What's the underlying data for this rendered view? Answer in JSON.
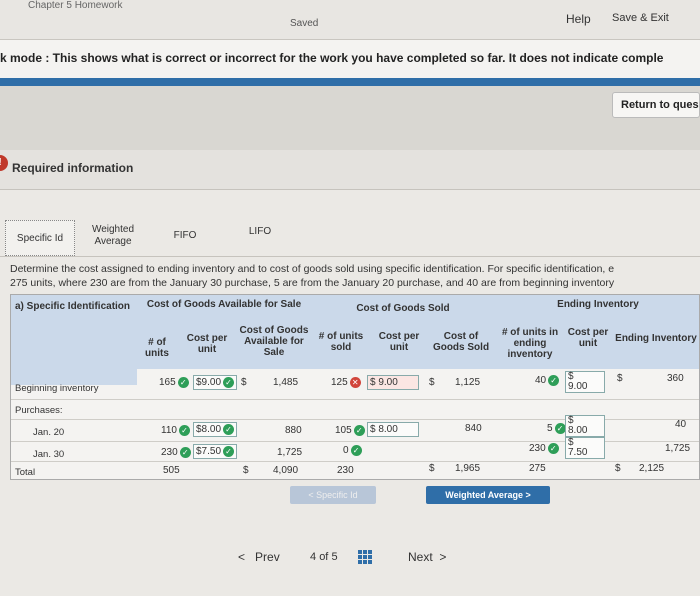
{
  "topbar": {
    "chapter": "Chapter 5 Homework",
    "saved": "Saved",
    "help": "Help",
    "save_exit": "Save & Exit"
  },
  "banner": {
    "text": "k mode : This shows what is correct or incorrect for the work you have completed so far. It does not indicate comple"
  },
  "return_button": "Return to ques",
  "required": {
    "icon": "!",
    "label": "Required information"
  },
  "tabs": [
    {
      "label": "Specific Id"
    },
    {
      "label": "Weighted Average"
    },
    {
      "label": "FIFO"
    },
    {
      "label": "LIFO"
    }
  ],
  "instructions": {
    "line1": "Determine the cost assigned to ending inventory and to cost of goods sold using specific identification. For specific identification, e",
    "line2": "275 units, where 230 are from the January 30 purchase, 5 are from the January 20 purchase, and 40 are from beginning inventory"
  },
  "table": {
    "corner": "a) Specific Identification",
    "groups": {
      "available": "Cost of Goods Available for Sale",
      "sold": "Cost of Goods Sold",
      "ending": "Ending Inventory"
    },
    "cols": {
      "units": "# of units",
      "cost_per_unit": "Cost per unit",
      "cost_available": "Cost of Goods Available for Sale",
      "units_sold": "# of units sold",
      "sold_cost_per_unit": "Cost per unit",
      "cost_sold": "Cost of Goods Sold",
      "units_ending": "# of units in ending inventory",
      "ending_cost_per_unit": "Cost per unit",
      "ending_inventory": "Ending Inventory"
    },
    "rows": {
      "beginning": {
        "label": "Beginning inventory",
        "units": "165",
        "cost": "$9.00",
        "avail_dollar": "$",
        "avail": "1,485",
        "sold_units": "125",
        "sold_cost": "$ 9.00",
        "sold_dollar": "$",
        "sold": "1,125",
        "end_units": "40",
        "end_cost_dollar": "$",
        "end_cost": "9.00",
        "end_dollar": "$",
        "end": "360"
      },
      "purchases": {
        "label": "Purchases:"
      },
      "jan20": {
        "label": "Jan. 20",
        "units": "110",
        "cost": "$8.00",
        "avail": "880",
        "sold_units": "105",
        "sold_cost": "$ 8.00",
        "sold": "840",
        "end_units": "5",
        "end_cost_dollar": "$",
        "end_cost": "8.00",
        "end": "40"
      },
      "jan30": {
        "label": "Jan. 30",
        "units": "230",
        "cost": "$7.50",
        "avail": "1,725",
        "sold_units": "0",
        "end_units": "230",
        "end_cost_dollar": "$",
        "end_cost": "7.50",
        "end": "1,725"
      },
      "total": {
        "label": "Total",
        "units": "505",
        "avail_dollar": "$",
        "avail": "4,090",
        "sold_units": "230",
        "sold_dollar": "$",
        "sold": "1,965",
        "end_units": "275",
        "end_dollar": "$",
        "end": "2,125"
      }
    }
  },
  "nav_buttons": {
    "left": "Specific Id",
    "right": "Weighted Average"
  },
  "pager": {
    "prev": "Prev",
    "page": "4",
    "of": "of",
    "total": "5",
    "next": "Next"
  },
  "colors": {
    "accent": "#2f6ea8",
    "correct": "#2e9e58",
    "incorrect": "#d1453b",
    "header": "#cbd9ea"
  }
}
